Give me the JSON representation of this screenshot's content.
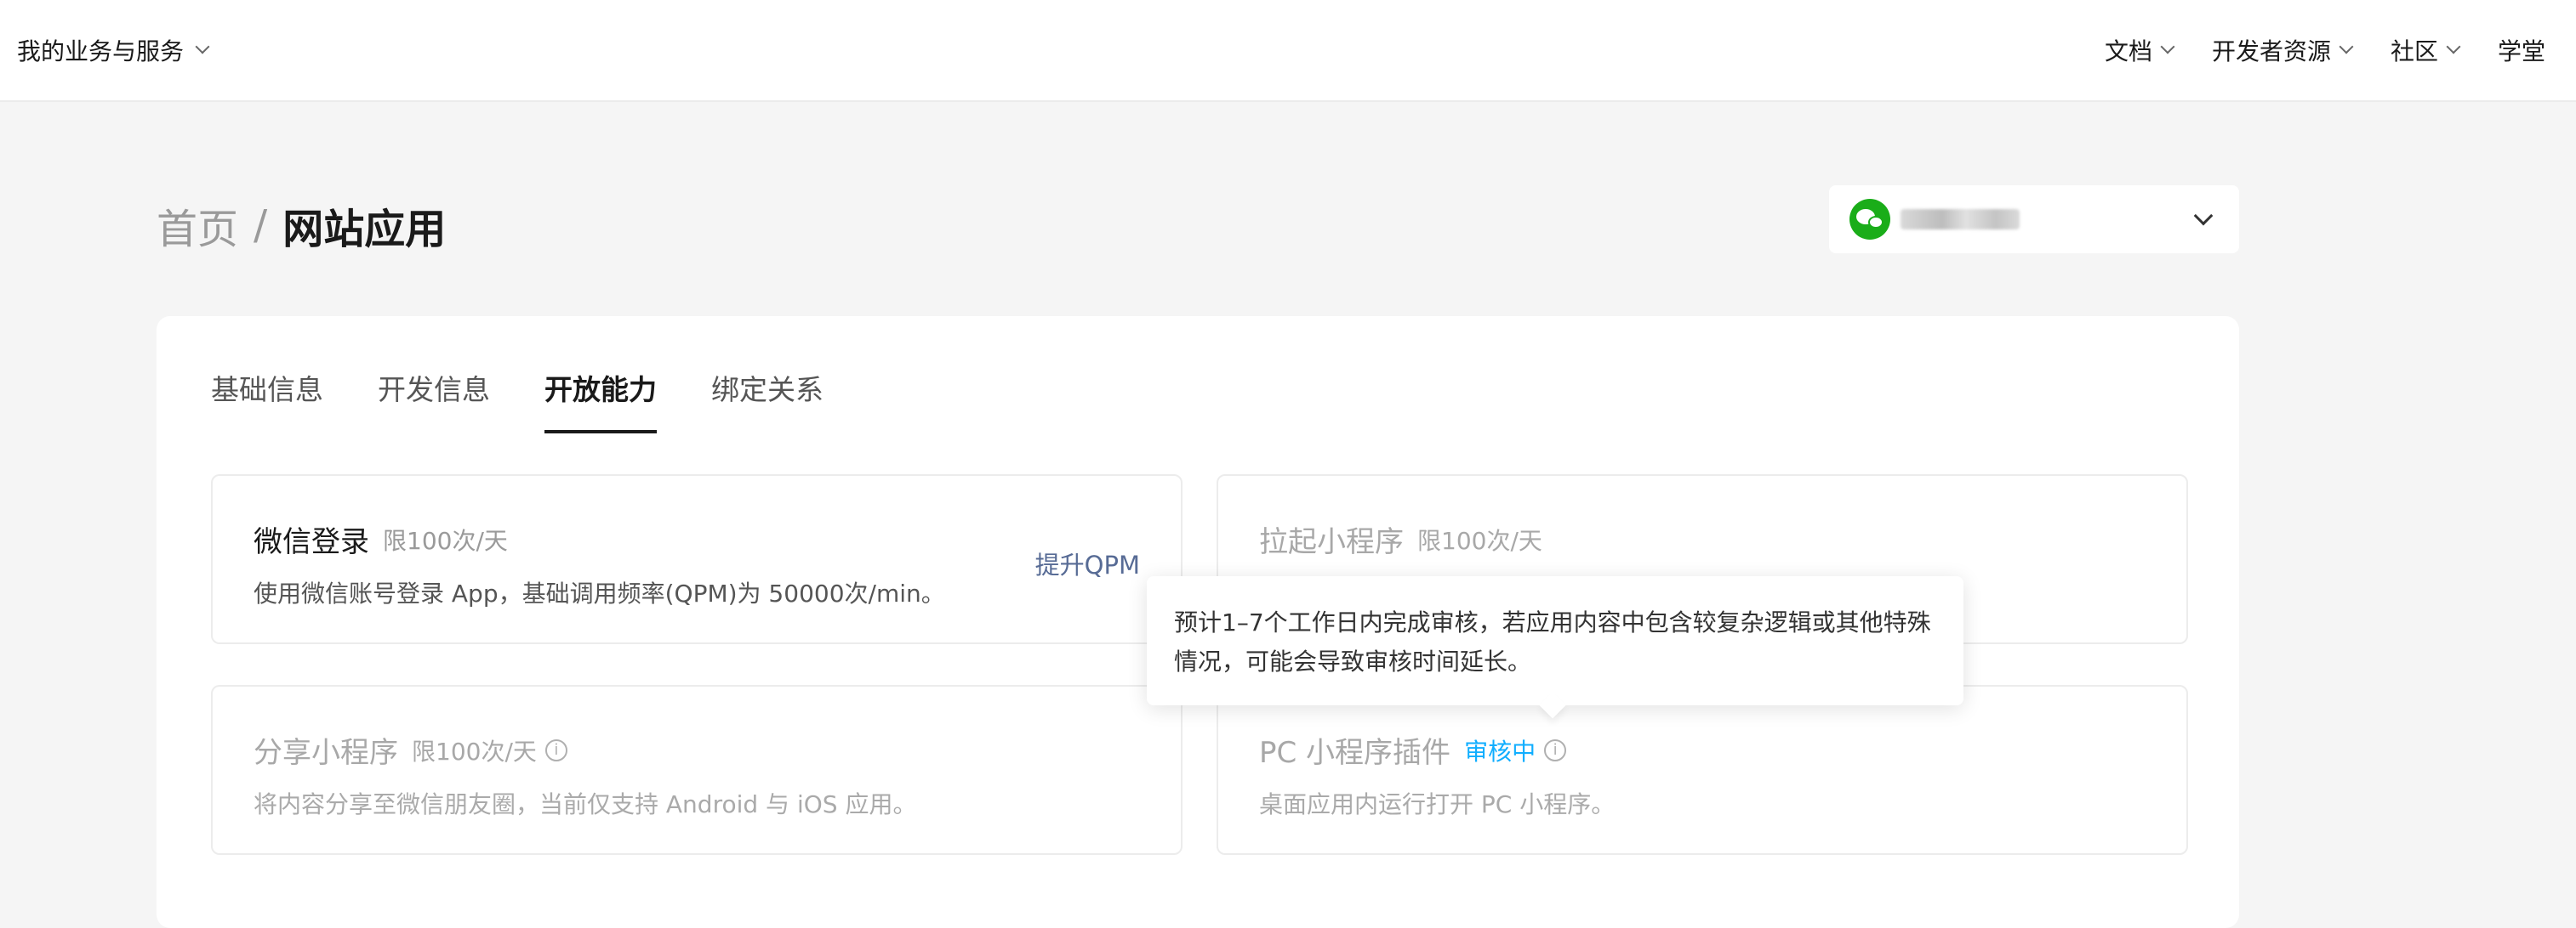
{
  "topbar": {
    "business_menu": "我的业务与服务",
    "nav": [
      {
        "label": "文档",
        "has_dropdown": true
      },
      {
        "label": "开发者资源",
        "has_dropdown": true
      },
      {
        "label": "社区",
        "has_dropdown": true
      },
      {
        "label": "学堂",
        "has_dropdown": false
      }
    ]
  },
  "breadcrumb": {
    "home": "首页",
    "separator": "/",
    "current": "网站应用"
  },
  "account_select": {
    "icon": "wechat-icon",
    "brand_color": "#1aad19"
  },
  "tabs": [
    {
      "label": "基础信息",
      "active": false
    },
    {
      "label": "开发信息",
      "active": false
    },
    {
      "label": "开放能力",
      "active": true
    },
    {
      "label": "绑定关系",
      "active": false
    }
  ],
  "features": [
    {
      "title": "微信登录",
      "limit": "限100次/天",
      "desc": "使用微信账号登录 App，基础调用频率(QPM)为 50000次/min。",
      "action": "提升QPM"
    },
    {
      "title": "拉起小程序",
      "limit": "限100次/天"
    },
    {
      "title": "分享小程序",
      "limit": "限100次/天",
      "desc": "将内容分享至微信朋友圈，当前仅支持 Android 与 iOS 应用。"
    },
    {
      "title": "PC 小程序插件",
      "status": "审核中",
      "desc": "桌面应用内运行打开 PC 小程序。"
    }
  ],
  "tooltip": {
    "text": "预计1–7个工作日内完成审核，若应用内容中包含较复杂逻辑或其他特殊情况，可能会导致审核时间延长。"
  },
  "colors": {
    "link": "#576b95",
    "review_status": "#10aeff",
    "page_bg": "#f5f5f5"
  }
}
